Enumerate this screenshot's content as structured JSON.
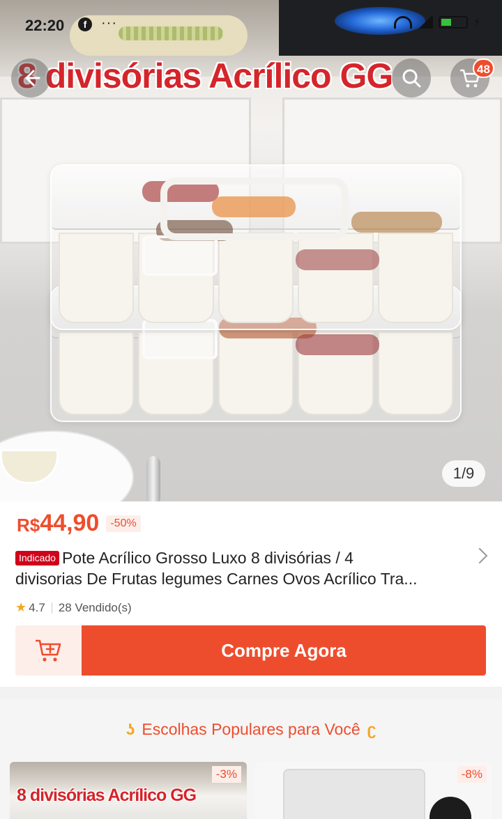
{
  "status_bar": {
    "time": "22:20",
    "more": "···"
  },
  "hero": {
    "overlay_title": "8 divisórias Acrílico GG",
    "image_counter": "1/9",
    "cart_count": "48"
  },
  "product": {
    "currency": "R$",
    "price": "44,90",
    "discount": "-50%",
    "tag": "Indicado",
    "title_line1": "Pote Acrílico  Grosso  Luxo 8 divisórias / 4",
    "title_line2": "divisorias De Frutas legumes Carnes Ovos Acrílico  Tra...",
    "rating": "4.7",
    "sold": "28 Vendido(s)",
    "buy_label": "Compre Agora"
  },
  "recommendations": {
    "header": "Escolhas Populares para Você",
    "items": [
      {
        "title": "8 divisórias Acrílico GG",
        "discount": "-3%"
      },
      {
        "title": "",
        "discount": "-8%"
      }
    ]
  },
  "colors": {
    "accent": "#ee4d2d",
    "title_red": "#d4252b",
    "tag_red": "#d0011b",
    "star": "#f5a623"
  },
  "icons": [
    "back-arrow-icon",
    "search-icon",
    "cart-icon",
    "chevron-right-icon",
    "star-icon",
    "add-to-cart-icon",
    "facebook-icon"
  ]
}
